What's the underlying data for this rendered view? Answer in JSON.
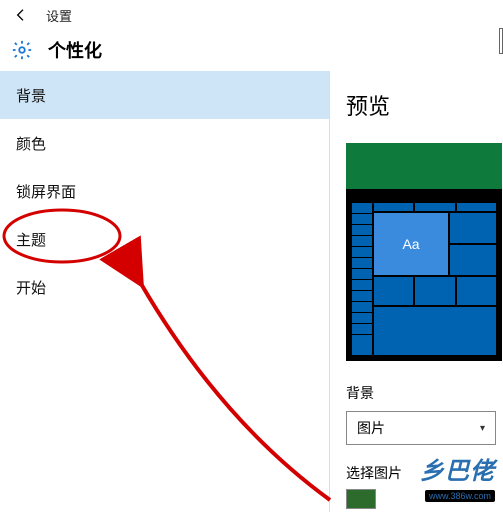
{
  "titlebar": {
    "title": "设置"
  },
  "header": {
    "title": "个性化"
  },
  "sidebar": {
    "items": [
      {
        "label": "背景",
        "selected": true
      },
      {
        "label": "颜色",
        "selected": false
      },
      {
        "label": "锁屏界面",
        "selected": false
      },
      {
        "label": "主题",
        "selected": false
      },
      {
        "label": "开始",
        "selected": false
      }
    ]
  },
  "main": {
    "preview_title": "预览",
    "tile_sample": "Aa",
    "bg_label": "背景",
    "bg_select_value": "图片",
    "choose_label": "选择图片"
  },
  "watermark": {
    "main": "乡巴佬",
    "sub": "www.386w.com"
  },
  "annotation": {
    "highlight_index": 3
  }
}
